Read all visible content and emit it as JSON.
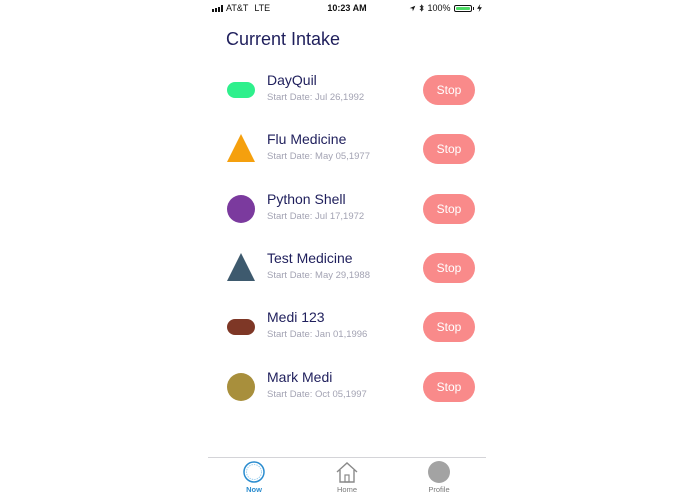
{
  "status_bar": {
    "carrier": "AT&T",
    "network": "LTE",
    "time": "10:23 AM",
    "battery": "100%",
    "icons": [
      "location-arrow-icon",
      "bluetooth-icon",
      "charging-bolt-icon"
    ]
  },
  "page": {
    "title": "Current Intake"
  },
  "medications": [
    {
      "name": "DayQuil",
      "start_date": "Start Date: Jul 26,1992",
      "shape": "pill",
      "color": "#2ef08c",
      "action": "Stop"
    },
    {
      "name": "Flu Medicine",
      "start_date": "Start Date: May 05,1977",
      "shape": "triangle",
      "color": "#f5a00e",
      "action": "Stop"
    },
    {
      "name": "Python Shell",
      "start_date": "Start Date: Jul 17,1972",
      "shape": "circle",
      "color": "#7b3a9e",
      "action": "Stop"
    },
    {
      "name": "Test Medicine",
      "start_date": "Start Date: May 29,1988",
      "shape": "triangle",
      "color": "#3e5a6e",
      "action": "Stop"
    },
    {
      "name": "Medi 123",
      "start_date": "Start Date: Jan 01,1996",
      "shape": "pill",
      "color": "#7e3726",
      "action": "Stop"
    },
    {
      "name": "Mark Medi",
      "start_date": "Start Date: Oct 05,1997",
      "shape": "circle",
      "color": "#a88f3c",
      "action": "Stop"
    }
  ],
  "accent_colors": {
    "stop_button": "#f98a8a",
    "title": "#1f1f5c",
    "active_tab": "#2a8ccf"
  },
  "tabs": [
    {
      "label": "Now",
      "icon": "now-ring-icon",
      "active": true
    },
    {
      "label": "Home",
      "icon": "home-icon",
      "active": false
    },
    {
      "label": "Profile",
      "icon": "profile-icon",
      "active": false
    }
  ]
}
